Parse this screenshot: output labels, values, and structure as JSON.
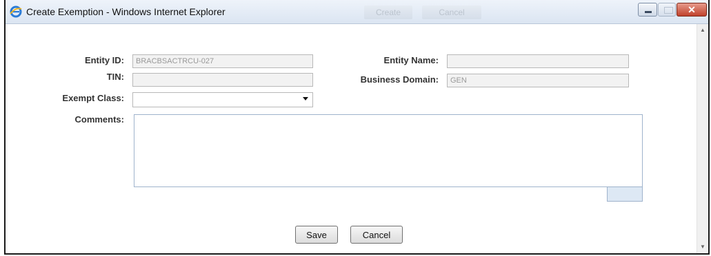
{
  "window": {
    "title": "Create Exemption - Windows Internet Explorer",
    "ghost_buttons": [
      "Create",
      "Cancel"
    ]
  },
  "form": {
    "entity_id": {
      "label": "Entity ID:",
      "value": "BRACBSACTRCU-027"
    },
    "entity_name": {
      "label": "Entity Name:",
      "value": ""
    },
    "tin": {
      "label": "TIN:",
      "value": ""
    },
    "business_domain": {
      "label": "Business Domain:",
      "value": "GEN"
    },
    "exempt_class": {
      "label": "Exempt Class:",
      "value": ""
    },
    "comments": {
      "label": "Comments:",
      "value": ""
    }
  },
  "actions": {
    "save": "Save",
    "cancel": "Cancel"
  },
  "colors": {
    "titlebar": "#dbe5f2",
    "close": "#c0422c",
    "field_bg": "#f2f2f2"
  },
  "icons": [
    "ie-icon",
    "minimize-icon",
    "maximize-icon",
    "close-icon",
    "dropdown-arrow-icon",
    "scroll-up-icon",
    "scroll-down-icon"
  ]
}
